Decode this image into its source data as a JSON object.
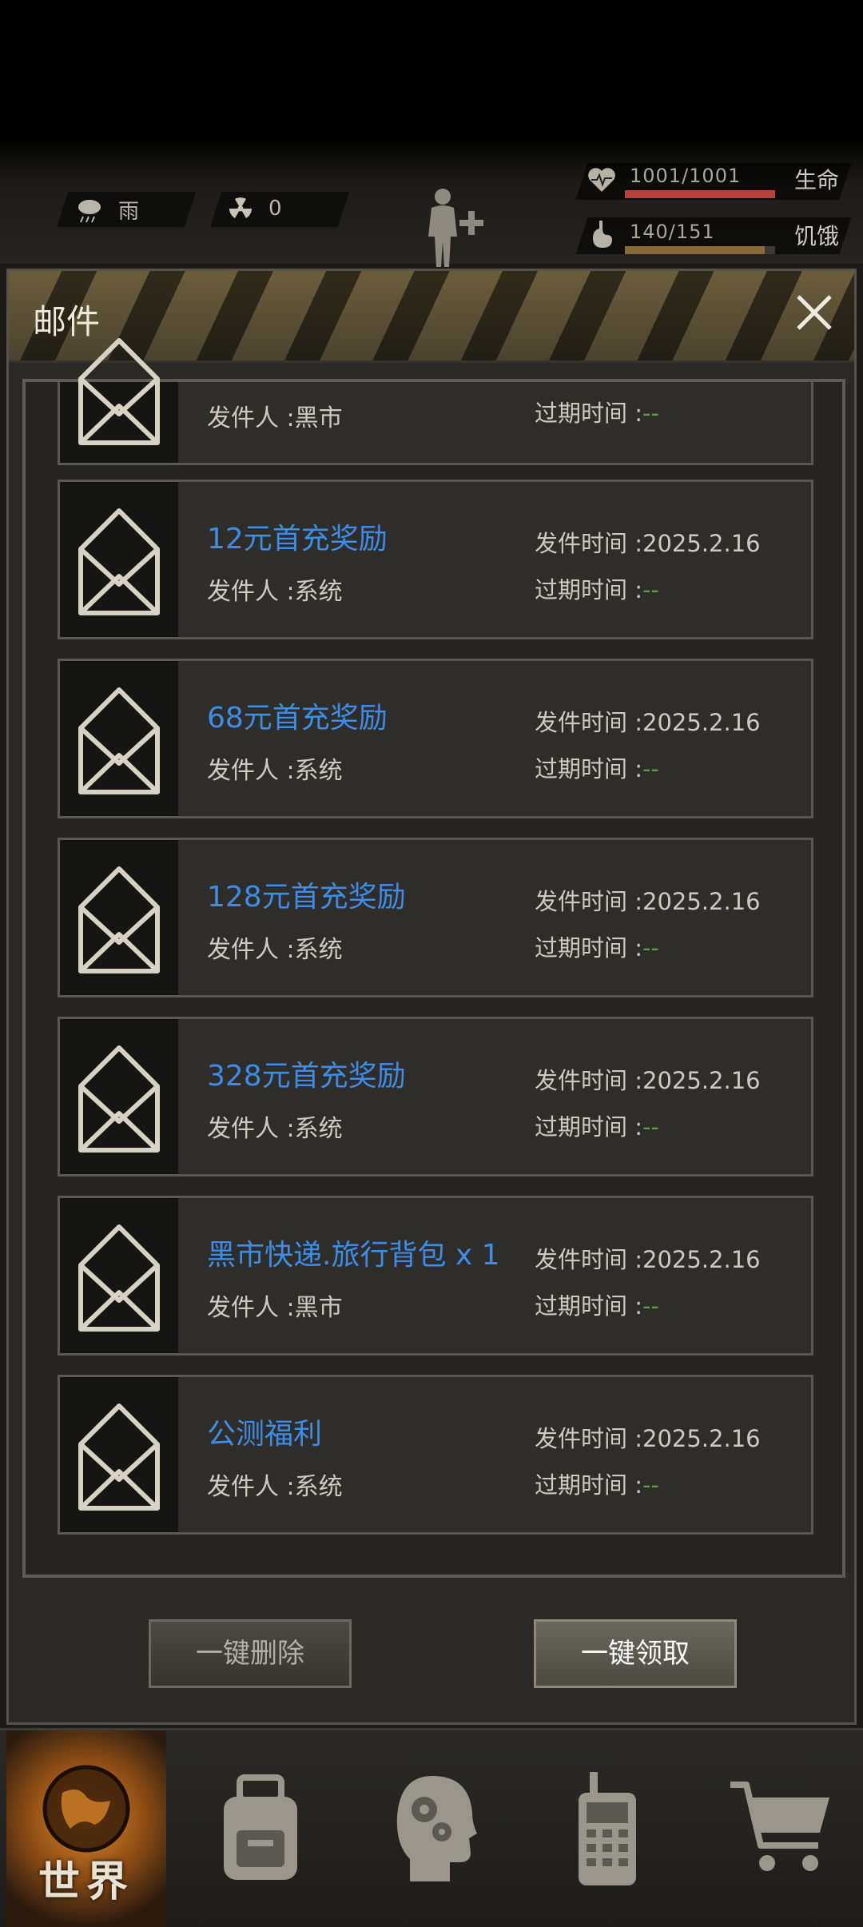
{
  "status": {
    "weather": {
      "icon": "rain-cloud-icon",
      "label": "雨"
    },
    "radiation": {
      "icon": "radiation-icon",
      "value": "0"
    },
    "health": {
      "icon": "heart-pulse-icon",
      "value": "1001/1001",
      "label": "生命",
      "fill_fraction": 1.0,
      "color": "#b8403a"
    },
    "hunger": {
      "icon": "stomach-icon",
      "value": "140/151",
      "label": "饥饿",
      "fill_fraction": 0.93,
      "color": "#8a6a3a"
    }
  },
  "panel": {
    "title": "邮件",
    "close_icon": "close-icon",
    "sender_prefix": "发件人 :",
    "sent_prefix": "发件时间 :",
    "expire_prefix": "过期时间 :",
    "partial_item": {
      "sender": "黑市",
      "expire": "--"
    },
    "mails": [
      {
        "title": "12元首充奖励",
        "sender": "系统",
        "sent": "2025.2.16",
        "expire": "--"
      },
      {
        "title": "68元首充奖励",
        "sender": "系统",
        "sent": "2025.2.16",
        "expire": "--"
      },
      {
        "title": "128元首充奖励",
        "sender": "系统",
        "sent": "2025.2.16",
        "expire": "--"
      },
      {
        "title": "328元首充奖励",
        "sender": "系统",
        "sent": "2025.2.16",
        "expire": "--"
      },
      {
        "title": "黑市快递.旅行背包 x 1",
        "sender": "黑市",
        "sent": "2025.2.16",
        "expire": "--"
      },
      {
        "title": "公测福利",
        "sender": "系统",
        "sent": "2025.2.16",
        "expire": "--"
      }
    ],
    "buttons": {
      "delete_all": "一键删除",
      "claim_all": "一键领取"
    }
  },
  "nav": {
    "world": "世界",
    "items": [
      "backpack-icon",
      "head-gears-icon",
      "radio-icon",
      "cart-icon"
    ]
  }
}
